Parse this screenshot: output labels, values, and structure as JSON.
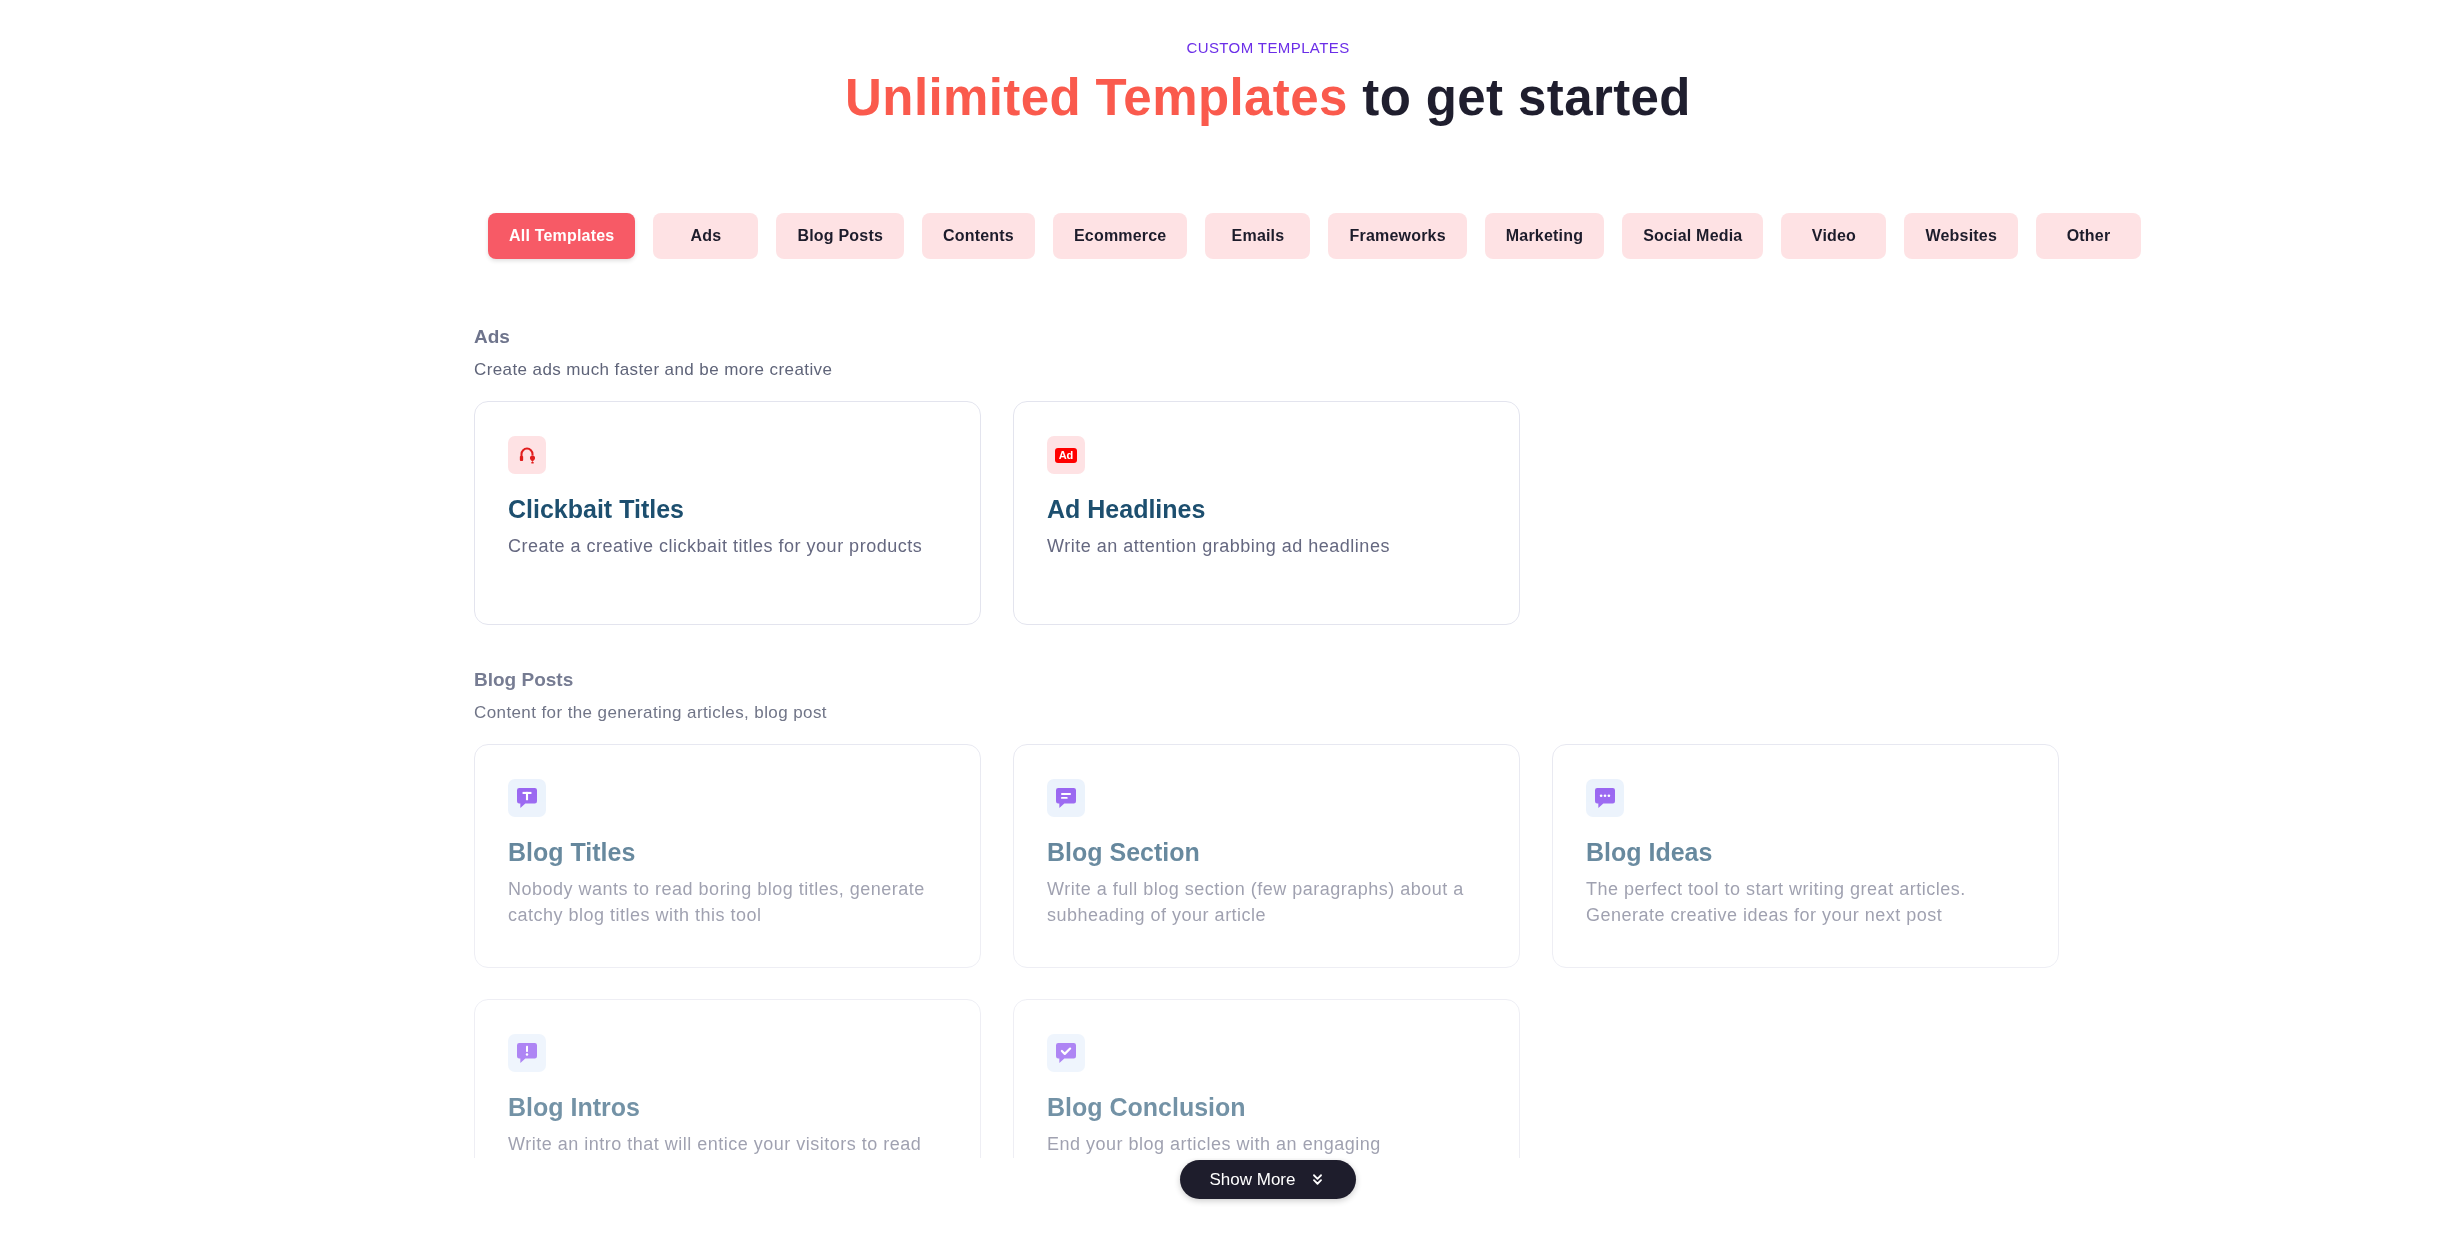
{
  "header": {
    "eyebrow": "CUSTOM TEMPLATES",
    "title_highlight": "Unlimited Templates",
    "title_rest": "to get started"
  },
  "tabs": [
    {
      "label": "All Templates",
      "selected": true
    },
    {
      "label": "Ads",
      "selected": false
    },
    {
      "label": "Blog Posts",
      "selected": false
    },
    {
      "label": "Contents",
      "selected": false
    },
    {
      "label": "Ecommerce",
      "selected": false
    },
    {
      "label": "Emails",
      "selected": false
    },
    {
      "label": "Frameworks",
      "selected": false
    },
    {
      "label": "Marketing",
      "selected": false
    },
    {
      "label": "Social Media",
      "selected": false
    },
    {
      "label": "Video",
      "selected": false
    },
    {
      "label": "Websites",
      "selected": false
    },
    {
      "label": "Other",
      "selected": false
    }
  ],
  "sections": [
    {
      "title": "Ads",
      "subtitle": "Create ads much faster and be more creative",
      "cards": [
        {
          "title": "Clickbait Titles",
          "description": "Create a creative clickbait titles for your products"
        },
        {
          "title": "Ad Headlines",
          "description": "Write an attention grabbing ad headlines",
          "icon_text": "Ad"
        }
      ]
    },
    {
      "title": "Blog Posts",
      "subtitle": "Content for the generating articles, blog post",
      "cards": [
        {
          "title": "Blog Titles",
          "description": "Nobody wants to read boring blog titles, generate catchy blog titles with this tool"
        },
        {
          "title": "Blog Section",
          "description": "Write a full blog section (few paragraphs) about a subheading of your article"
        },
        {
          "title": "Blog Ideas",
          "description": "The perfect tool to start writing great articles. Generate creative ideas for your next post"
        },
        {
          "title": "Blog Intros",
          "description": "Write an intro that will entice your visitors to read"
        },
        {
          "title": "Blog Conclusion",
          "description": "End your blog articles with an engaging"
        }
      ]
    }
  ],
  "show_more": {
    "label": "Show More"
  }
}
